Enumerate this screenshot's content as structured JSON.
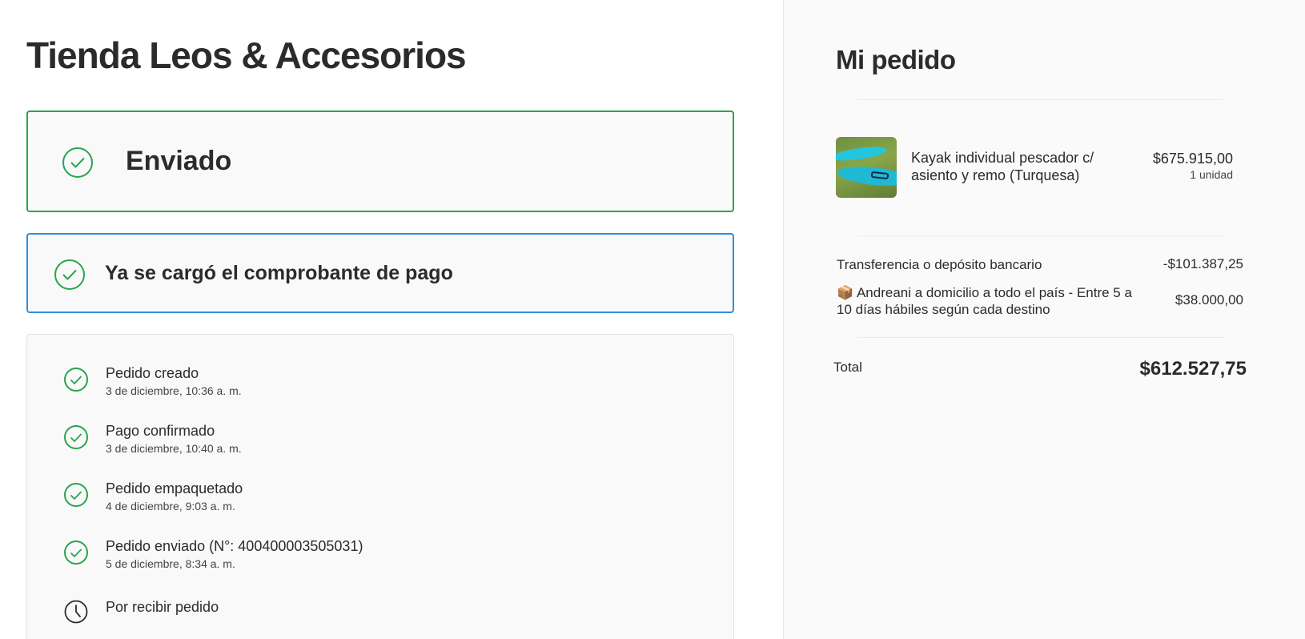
{
  "store": {
    "title": "Tienda Leos & Accesorios"
  },
  "status": {
    "shipped_label": "Enviado",
    "payment_label": "Ya se cargó el comprobante de pago"
  },
  "timeline": [
    {
      "title": "Pedido creado",
      "date": "3 de diciembre, 10:36 a. m.",
      "icon": "check-icon"
    },
    {
      "title": "Pago confirmado",
      "date": "3 de diciembre, 10:40 a. m.",
      "icon": "check-icon"
    },
    {
      "title": "Pedido empaquetado",
      "date": "4 de diciembre, 9:03 a. m.",
      "icon": "check-icon"
    },
    {
      "title": "Pedido enviado (N°: 400400003505031)",
      "date": "5 de diciembre, 8:34 a. m.",
      "icon": "check-icon"
    },
    {
      "title": "Por recibir pedido",
      "date": "",
      "icon": "clock-icon"
    }
  ],
  "order": {
    "title": "Mi pedido",
    "product": {
      "name": "Kayak individual pescador c/ asiento y remo (Turquesa)",
      "price": "$675.915,00",
      "quantity": "1 unidad"
    },
    "lines": [
      {
        "label": "Transferencia o depósito bancario",
        "value": "-$101.387,25"
      },
      {
        "label": "📦 Andreani a domicilio a todo el país - Entre 5 a 10 días hábiles según cada destino",
        "value": "$38.000,00"
      }
    ],
    "total_label": "Total",
    "total_value": "$612.527,75"
  },
  "colors": {
    "success": "#2aa44f",
    "info": "#2d8fe0",
    "text": "#2b2b2b"
  }
}
